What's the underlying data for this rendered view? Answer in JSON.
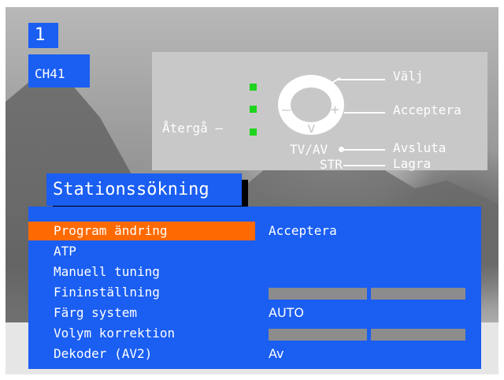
{
  "channel": {
    "number": "1",
    "name": "CH41"
  },
  "help": {
    "back_label": "Återgå –",
    "select_label": "Välj",
    "accept_label": "Acceptera",
    "exit_key": "TV/AV",
    "exit_label": "Avsluta",
    "store_key": "STR",
    "store_label": "Lagra",
    "up_glyph": "^",
    "down_glyph": "v",
    "plus_glyph": "+",
    "minus_glyph": "–"
  },
  "menu": {
    "title": "Stationssökning",
    "items": [
      {
        "label": "Program ändring",
        "value": "Acceptera",
        "selected": true
      },
      {
        "label": "ATP",
        "value": ""
      },
      {
        "label": "Manuell tuning",
        "value": ""
      },
      {
        "label": "Fininställning",
        "value": ""
      },
      {
        "label": "Färg system",
        "value": "AUTO"
      },
      {
        "label": "Volym korrektion",
        "value": ""
      },
      {
        "label": "Dekoder (AV2)",
        "value": "Av"
      }
    ]
  },
  "colors": {
    "panel_blue": "#1a5ef2",
    "highlight": "#ff6a00",
    "led_green": "#1ed41e",
    "help_bg": "#c8c8c8"
  },
  "icons": [
    "remote-ring-icon",
    "led-indicator-icon"
  ]
}
